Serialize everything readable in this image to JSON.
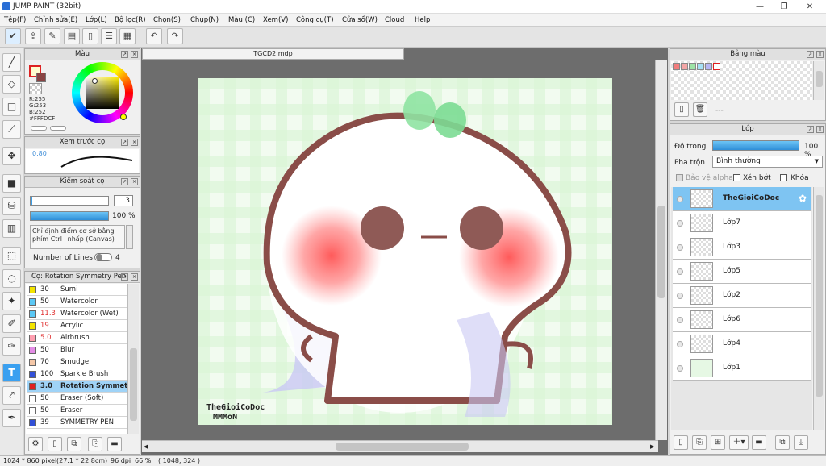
{
  "window": {
    "title": "JUMP PAINT (32bit)"
  },
  "menu": [
    "Tệp(F)",
    "Chỉnh sửa(E)",
    "Lớp(L)",
    "Bộ lọc(R)",
    "Chọn(S)",
    "Chụp(N)",
    "Màu (C)",
    "Xem(V)",
    "Công cụ(T)",
    "Cửa sổ(W)",
    "Cloud",
    "Help"
  ],
  "color_panel": {
    "title": "Màu",
    "r": "R:255",
    "g": "G:253",
    "b": "B:252",
    "hex": "#FFFDCF"
  },
  "brush_preview": {
    "title": "Xem trước cọ",
    "size": "0.80"
  },
  "brush_control": {
    "title": "Kiểm soát cọ",
    "size_value": "3",
    "opacity_value": "100 %",
    "hint": "Chỉ định điểm cơ sở bằng phím Ctrl+nhấp (Canvas)",
    "lines_label": "Number of Lines",
    "lines_value": "4"
  },
  "brush_list": {
    "title": "Cọ: Rotation Symmetry Pen",
    "items": [
      {
        "size": "30",
        "name": "Sumi",
        "color": "#f3e400",
        "size_red": false
      },
      {
        "size": "50",
        "name": "Watercolor",
        "color": "#5bc8f5",
        "size_red": false
      },
      {
        "size": "11.3",
        "name": "Watercolor (Wet)",
        "color": "#5bc8f5",
        "size_red": true
      },
      {
        "size": "19",
        "name": "Acrylic",
        "color": "#f3e400",
        "size_red": true
      },
      {
        "size": "5.0",
        "name": "Airbrush",
        "color": "#ff9fb0",
        "size_red": true
      },
      {
        "size": "50",
        "name": "Blur",
        "color": "#e48ce6",
        "size_red": false
      },
      {
        "size": "70",
        "name": "Smudge",
        "color": "#f5c8a8",
        "size_red": false
      },
      {
        "size": "100",
        "name": "Sparkle Brush",
        "color": "#3250d8",
        "size_red": false
      },
      {
        "size": "3.0",
        "name": "Rotation Symmetry Pen",
        "color": "#e02020",
        "size_red": false,
        "selected": true
      },
      {
        "size": "50",
        "name": "Eraser (Soft)",
        "color": "#ffffff",
        "size_red": false
      },
      {
        "size": "50",
        "name": "Eraser",
        "color": "#ffffff",
        "size_red": false
      },
      {
        "size": "39",
        "name": "SYMMETRY PEN",
        "color": "#3250d8",
        "size_red": false
      }
    ]
  },
  "document": {
    "tab": "TGCD2.mdp",
    "watermark_line1": "TheGioiCoDoc",
    "watermark_line2": "MMMoN"
  },
  "palette_panel": {
    "title": "Bảng màu",
    "swatches": [
      "#f27d7d",
      "#f4a6a6",
      "#9ee3a6",
      "#a6e0f4",
      "#b6b6f4",
      "#ffffff"
    ],
    "dashes": "---"
  },
  "layers_panel": {
    "title": "Lớp",
    "opacity_label": "Độ trong",
    "opacity_value": "100 %",
    "blend_label": "Pha trộn",
    "blend_value": "Bình thường",
    "alpha_protect": "Bảo vệ alpha",
    "clipping": "Xén bớt",
    "lock": "Khóa",
    "layers": [
      "TheGioiCoDoc",
      "Lớp7",
      "Lớp3",
      "Lớp5",
      "Lớp2",
      "Lớp6",
      "Lớp4",
      "Lớp1"
    ]
  },
  "status": {
    "size": "1024 * 860 pixel",
    "cm": "(27.1 * 22.8cm)",
    "dpi": "96 dpi",
    "zoom": "66 %",
    "coords": "( 1048, 324 )"
  }
}
